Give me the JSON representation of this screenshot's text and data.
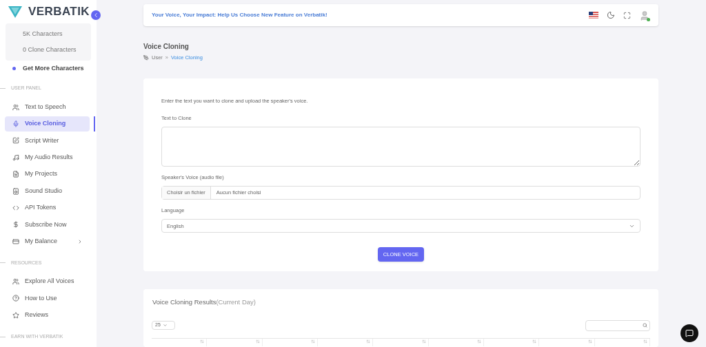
{
  "brand": {
    "name": "VERBATIK"
  },
  "sidebar": {
    "credits": [
      "5K Characters",
      "0 Clone Characters"
    ],
    "cta": "Get More Characters",
    "sections": [
      {
        "title": "USER PANEL",
        "items": [
          {
            "label": "Text to Speech",
            "selected": false
          },
          {
            "label": "Voice Cloning",
            "selected": true
          },
          {
            "label": "Script Writer",
            "selected": false
          },
          {
            "label": "My Audio Results",
            "selected": false
          },
          {
            "label": "My Projects",
            "selected": false
          },
          {
            "label": "Sound Studio",
            "selected": false
          },
          {
            "label": "API Tokens",
            "selected": false
          },
          {
            "label": "Subscribe Now",
            "selected": false
          },
          {
            "label": "My Balance",
            "selected": false,
            "expandable": true
          }
        ]
      },
      {
        "title": "RESOURCES",
        "items": [
          {
            "label": "Explore All Voices",
            "selected": false
          },
          {
            "label": "How to Use",
            "selected": false
          },
          {
            "label": "Reviews",
            "selected": false
          }
        ]
      },
      {
        "title": "EARN WITH VERBATIK"
      }
    ]
  },
  "banner": {
    "text": "Your Voice, Your Impact: Help Us Choose New Feature on Verbatik!"
  },
  "page": {
    "title": "Voice Cloning",
    "breadcrumb": [
      "User",
      "»",
      "Voice Cloning"
    ]
  },
  "form": {
    "intro": "Enter the text you want to clone and upload the speaker's voice.",
    "text_label": "Text to Clone",
    "file_label": "Speaker's Voice (audio file)",
    "file_button": "Choisir un fichier",
    "file_status": "Aucun fichier choisi",
    "language_label": "Language",
    "language_value": "English",
    "submit": "CLONE VOICE"
  },
  "results": {
    "title": "Voice Cloning Results",
    "subtitle": "(Current Day)",
    "page_size": "25"
  }
}
